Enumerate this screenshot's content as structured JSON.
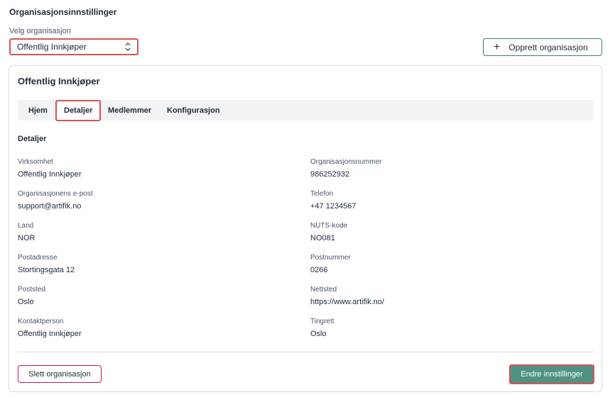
{
  "page": {
    "title": "Organisasjonsinnstillinger",
    "select_label": "Velg organisasjon",
    "selected_org": "Offentlig Innkjøper",
    "create_button": "Opprett organisasjon"
  },
  "card": {
    "title": "Offentlig Innkjøper",
    "tabs": [
      {
        "label": "Hjem",
        "active": false
      },
      {
        "label": "Detaljer",
        "active": true
      },
      {
        "label": "Medlemmer",
        "active": false
      },
      {
        "label": "Konfigurasjon",
        "active": false
      }
    ],
    "section_title": "Detaljer",
    "fields": {
      "virksomhet": {
        "label": "Virksomhet",
        "value": "Offentlig Innkjøper"
      },
      "orgnr": {
        "label": "Organisasjonsnummer",
        "value": "986252932"
      },
      "epost": {
        "label": "Organisasjonens e-post",
        "value": "support@artifik.no"
      },
      "telefon": {
        "label": "Telefon",
        "value": "+47 1234567"
      },
      "land": {
        "label": "Land",
        "value": "NOR"
      },
      "nuts": {
        "label": "NUTS-kode",
        "value": "NO081"
      },
      "postadresse": {
        "label": "Postadresse",
        "value": "Stortingsgata 12"
      },
      "postnummer": {
        "label": "Postnummer",
        "value": "0266"
      },
      "poststed": {
        "label": "Poststed",
        "value": "Oslo"
      },
      "nettsted": {
        "label": "Nettsted",
        "value": "https://www.artifik.no/"
      },
      "kontaktperson": {
        "label": "Kontaktperson",
        "value": "Offentlig Innkjøper"
      },
      "tingrett": {
        "label": "Tingrett",
        "value": "Oslo"
      }
    },
    "delete_button": "Slett organisasjon",
    "save_button": "Endre innstillinger"
  },
  "colors": {
    "accent": "#4e9283",
    "highlight": "#d9534f",
    "delete_border": "#c2185b"
  }
}
